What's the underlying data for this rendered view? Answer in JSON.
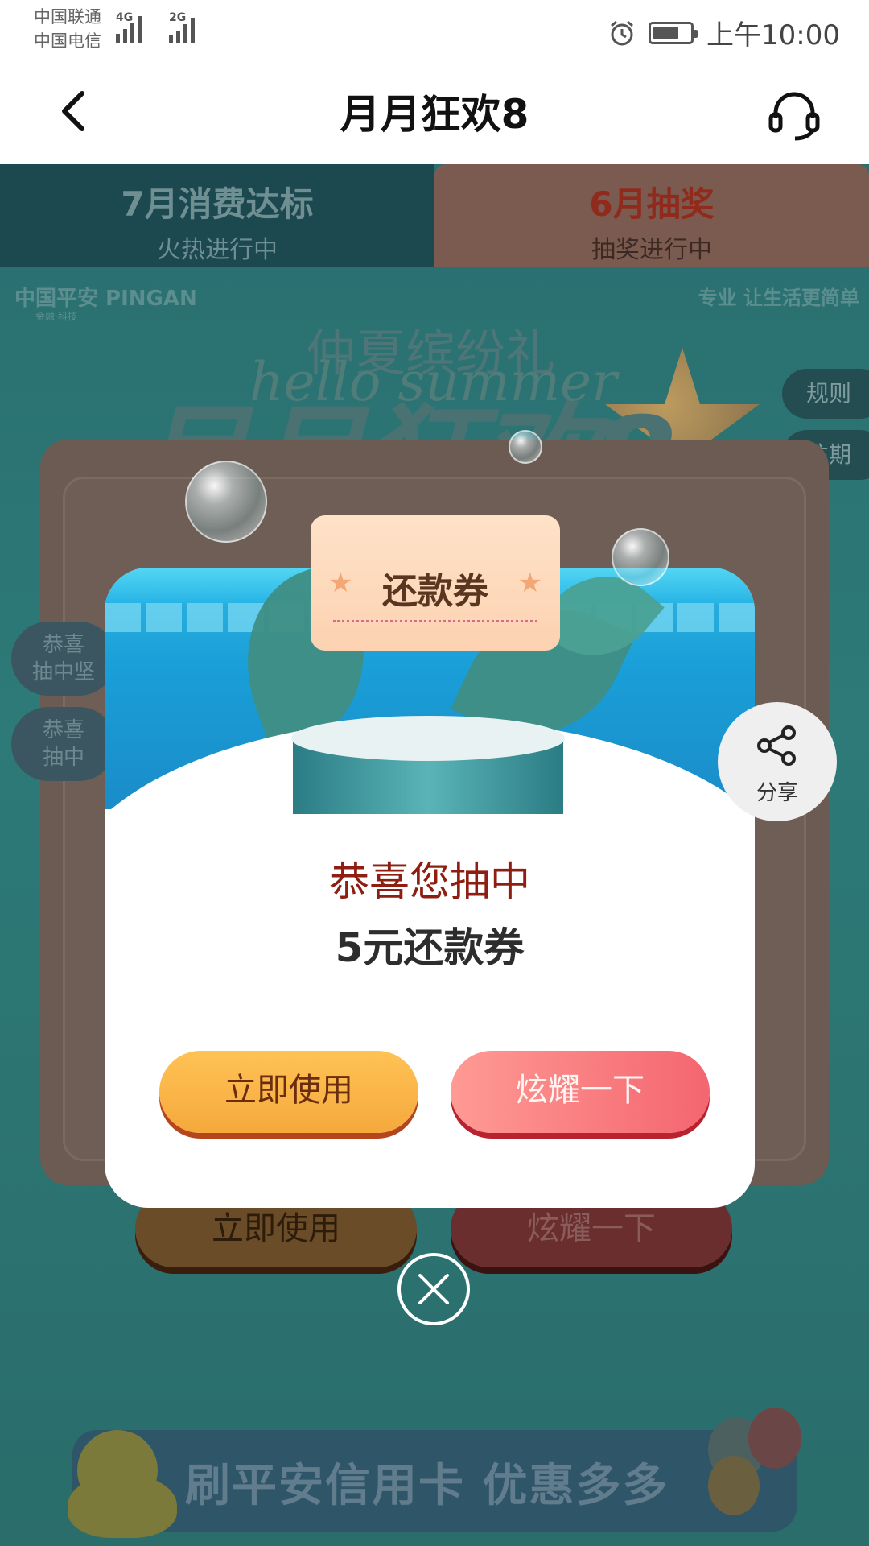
{
  "status_bar": {
    "carrier1": "中国联通",
    "carrier2": "中国电信",
    "net1": "4G",
    "net2": "2G",
    "time": "上午10:00",
    "battery_level": 0.7
  },
  "header": {
    "title": "月月狂欢8",
    "back_icon": "chevron-left-icon",
    "support_icon": "headset-icon"
  },
  "tabs": [
    {
      "title": "7月消费达标",
      "subtitle": "火热进行中"
    },
    {
      "title": "6月抽奖",
      "subtitle": "抽奖进行中"
    }
  ],
  "banner": {
    "brand": "中国平安 PINGAN",
    "brand_sub": "金融·科技",
    "slogan": "专业 让生活更简单",
    "subtitle": "仲夏缤纷礼",
    "script": "hello summer",
    "title": "月月狂欢8"
  },
  "side_buttons": {
    "rules": "规则",
    "history": "往期"
  },
  "background": {
    "pill1": "恭喜\n抽中坚",
    "pill2": "恭喜\n抽中",
    "use_label": "立即使用",
    "show_label": "炫耀一下",
    "footer_text": "刷平安信用卡 优惠多多"
  },
  "dialog": {
    "coupon_label": "还款券",
    "congrats": "恭喜您抽中",
    "prize": "5元还款券",
    "use_label": "立即使用",
    "show_label": "炫耀一下"
  },
  "share": {
    "label": "分享",
    "icon": "share-icon"
  },
  "close": {
    "icon": "close-icon"
  },
  "colors": {
    "accent": "#f46670",
    "gold": "#f5a93c",
    "congrats": "#8e1d12"
  }
}
